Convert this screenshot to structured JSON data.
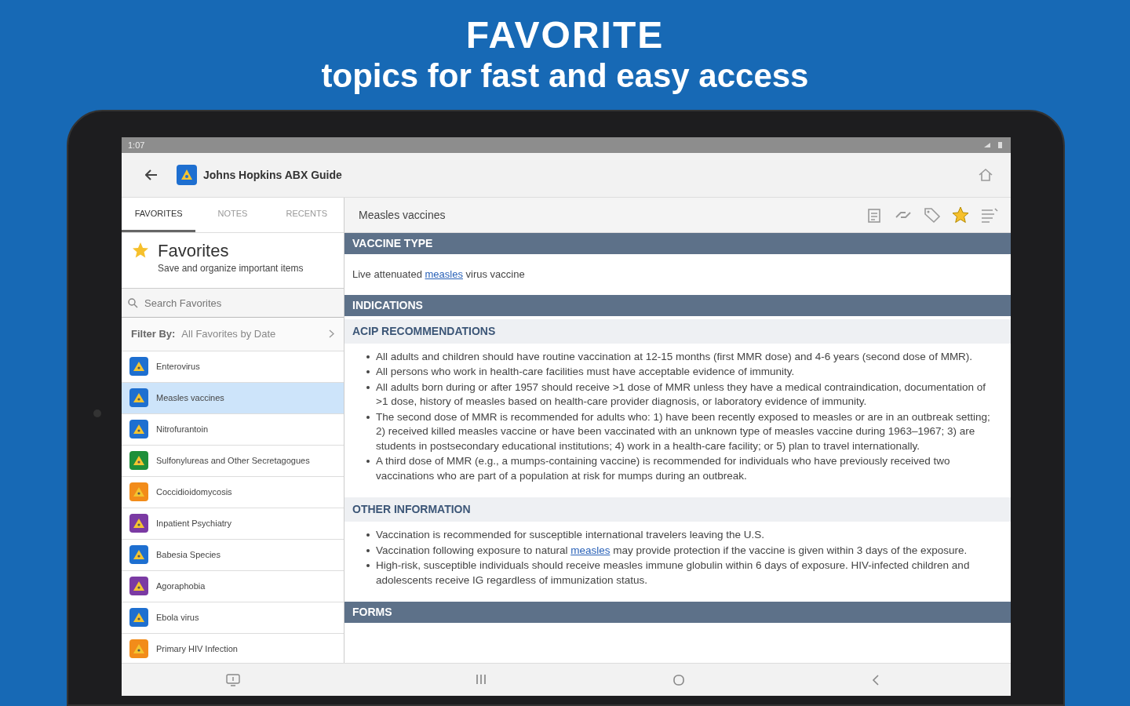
{
  "headline": {
    "title": "FAVORITE",
    "subtitle": "topics for fast and easy access"
  },
  "status_bar": {
    "time": "1:07"
  },
  "app_bar": {
    "title": "Johns Hopkins ABX Guide"
  },
  "sidebar": {
    "tabs": [
      {
        "label": "FAVORITES",
        "selected": true
      },
      {
        "label": "NOTES",
        "selected": false
      },
      {
        "label": "RECENTS",
        "selected": false
      }
    ],
    "header": {
      "title": "Favorites",
      "subtitle": "Save and organize important items"
    },
    "search": {
      "placeholder": "Search Favorites"
    },
    "filter": {
      "label": "Filter By:",
      "value": "All Favorites by Date"
    },
    "items": [
      {
        "label": "Enterovirus",
        "color": "#1e6fd0",
        "selected": false
      },
      {
        "label": "Measles vaccines",
        "color": "#1e6fd0",
        "selected": true
      },
      {
        "label": "Nitrofurantoin",
        "color": "#1e6fd0",
        "selected": false
      },
      {
        "label": "Sulfonylureas and Other Secretagogues",
        "color": "#1e8f3a",
        "selected": false
      },
      {
        "label": "Coccidioidomycosis",
        "color": "#f28c1a",
        "selected": false
      },
      {
        "label": "Inpatient Psychiatry",
        "color": "#7b3aa3",
        "selected": false
      },
      {
        "label": "Babesia Species",
        "color": "#1e6fd0",
        "selected": false
      },
      {
        "label": "Agoraphobia",
        "color": "#7b3aa3",
        "selected": false
      },
      {
        "label": "Ebola virus",
        "color": "#1e6fd0",
        "selected": false
      },
      {
        "label": "Primary HIV Infection",
        "color": "#f28c1a",
        "selected": false
      }
    ]
  },
  "article": {
    "title": "Measles vaccines",
    "favorited": true,
    "sections": [
      {
        "kind": "header",
        "title": "VACCINE TYPE"
      },
      {
        "kind": "paragraph",
        "parts": [
          {
            "text": "Live attenuated "
          },
          {
            "text": "measles",
            "kind": "link"
          },
          {
            "text": " virus vaccine"
          }
        ]
      },
      {
        "kind": "header",
        "title": "INDICATIONS"
      },
      {
        "kind": "subheader",
        "title": "ACIP RECOMMENDATIONS"
      },
      {
        "kind": "bullets",
        "items": [
          {
            "parts": [
              {
                "text": "All adults and children should have routine vaccination at 12-15 months (first MMR dose) and 4-6 years (second dose of MMR)."
              }
            ]
          },
          {
            "parts": [
              {
                "text": "All persons who work in health-care facilities must have acceptable evidence of immunity."
              }
            ]
          },
          {
            "parts": [
              {
                "text": "All adults born during or after 1957 should receive >1 dose of MMR unless they have a medical contraindication, documentation of >1 dose, history of measles based on health-care provider diagnosis, or laboratory evidence of immunity."
              }
            ]
          },
          {
            "parts": [
              {
                "text": "The second dose of MMR is recommended for adults who: 1) have been recently exposed to measles or are in an outbreak setting; 2) received killed measles vaccine or have been vaccinated with an unknown type of measles vaccine during 1963–1967; 3) are students in postsecondary educational institutions; 4) work in a health-care facility; or 5) plan to travel internationally."
              }
            ]
          },
          {
            "parts": [
              {
                "text": "A third dose of MMR (e.g., a mumps-containing vaccine) is recommended for individuals who have previously received two vaccinations who are part of a population at risk for mumps during an outbreak."
              }
            ]
          }
        ]
      },
      {
        "kind": "subheader",
        "title": "OTHER INFORMATION"
      },
      {
        "kind": "bullets",
        "items": [
          {
            "parts": [
              {
                "text": "Vaccination is recommended for susceptible international travelers leaving the U.S."
              }
            ]
          },
          {
            "parts": [
              {
                "text": "Vaccination following exposure to natural "
              },
              {
                "text": "measles",
                "kind": "link"
              },
              {
                "text": " may provide protection if the vaccine is given within 3 days of the exposure."
              }
            ]
          },
          {
            "parts": [
              {
                "text": "High-risk, susceptible individuals should receive measles immune globulin within 6 days of exposure. HIV-infected children and adolescents receive IG regardless of immunization status."
              }
            ]
          }
        ]
      },
      {
        "kind": "header",
        "title": "FORMS"
      }
    ]
  }
}
